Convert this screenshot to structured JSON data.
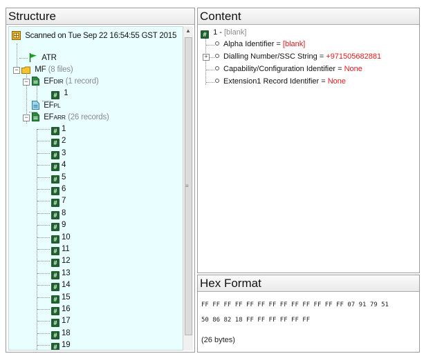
{
  "structure": {
    "title": "Structure",
    "scanned": "Scanned on Tue Sep 22 16:54:55 GST 2015",
    "atr": "ATR",
    "mf": {
      "label": "MF",
      "count": "(8 files)"
    },
    "efdir": {
      "prefix": "EF",
      "sub": "DIR",
      "count": "(1 record)",
      "records": [
        "1"
      ]
    },
    "efpl": {
      "prefix": "EF",
      "sub": "PL"
    },
    "efarr": {
      "prefix": "EF",
      "sub": "ARR",
      "count": "(26 records)",
      "records": [
        "1",
        "2",
        "3",
        "4",
        "5",
        "6",
        "7",
        "8",
        "9",
        "10",
        "11",
        "12",
        "13",
        "14",
        "15",
        "16",
        "17",
        "18",
        "19"
      ]
    }
  },
  "content": {
    "title": "Content",
    "record": {
      "number": "1 -",
      "value": "[blank]"
    },
    "fields": [
      {
        "label": "Alpha Identifier = ",
        "value": "[blank]",
        "expandable": false
      },
      {
        "label": "Dialling Number/SSC String = ",
        "value": "+971505682881",
        "expandable": true
      },
      {
        "label": "Capability/Configuration Identifier = ",
        "value": "None",
        "expandable": false
      },
      {
        "label": "Extension1 Record Identifier = ",
        "value": "None",
        "expandable": false
      }
    ]
  },
  "hex": {
    "title": "Hex Format",
    "line1": "FF FF FF FF FF FF FF FF FF FF FF FF FF 07 91 79 51",
    "line2": "50 86 82 18 FF FF FF FF FF FF",
    "bytes": "(26 bytes)"
  },
  "colors": {
    "tree_bg": "#e9ffff",
    "value_red": "#e8141a",
    "record_icon": "#1e5f2d"
  }
}
